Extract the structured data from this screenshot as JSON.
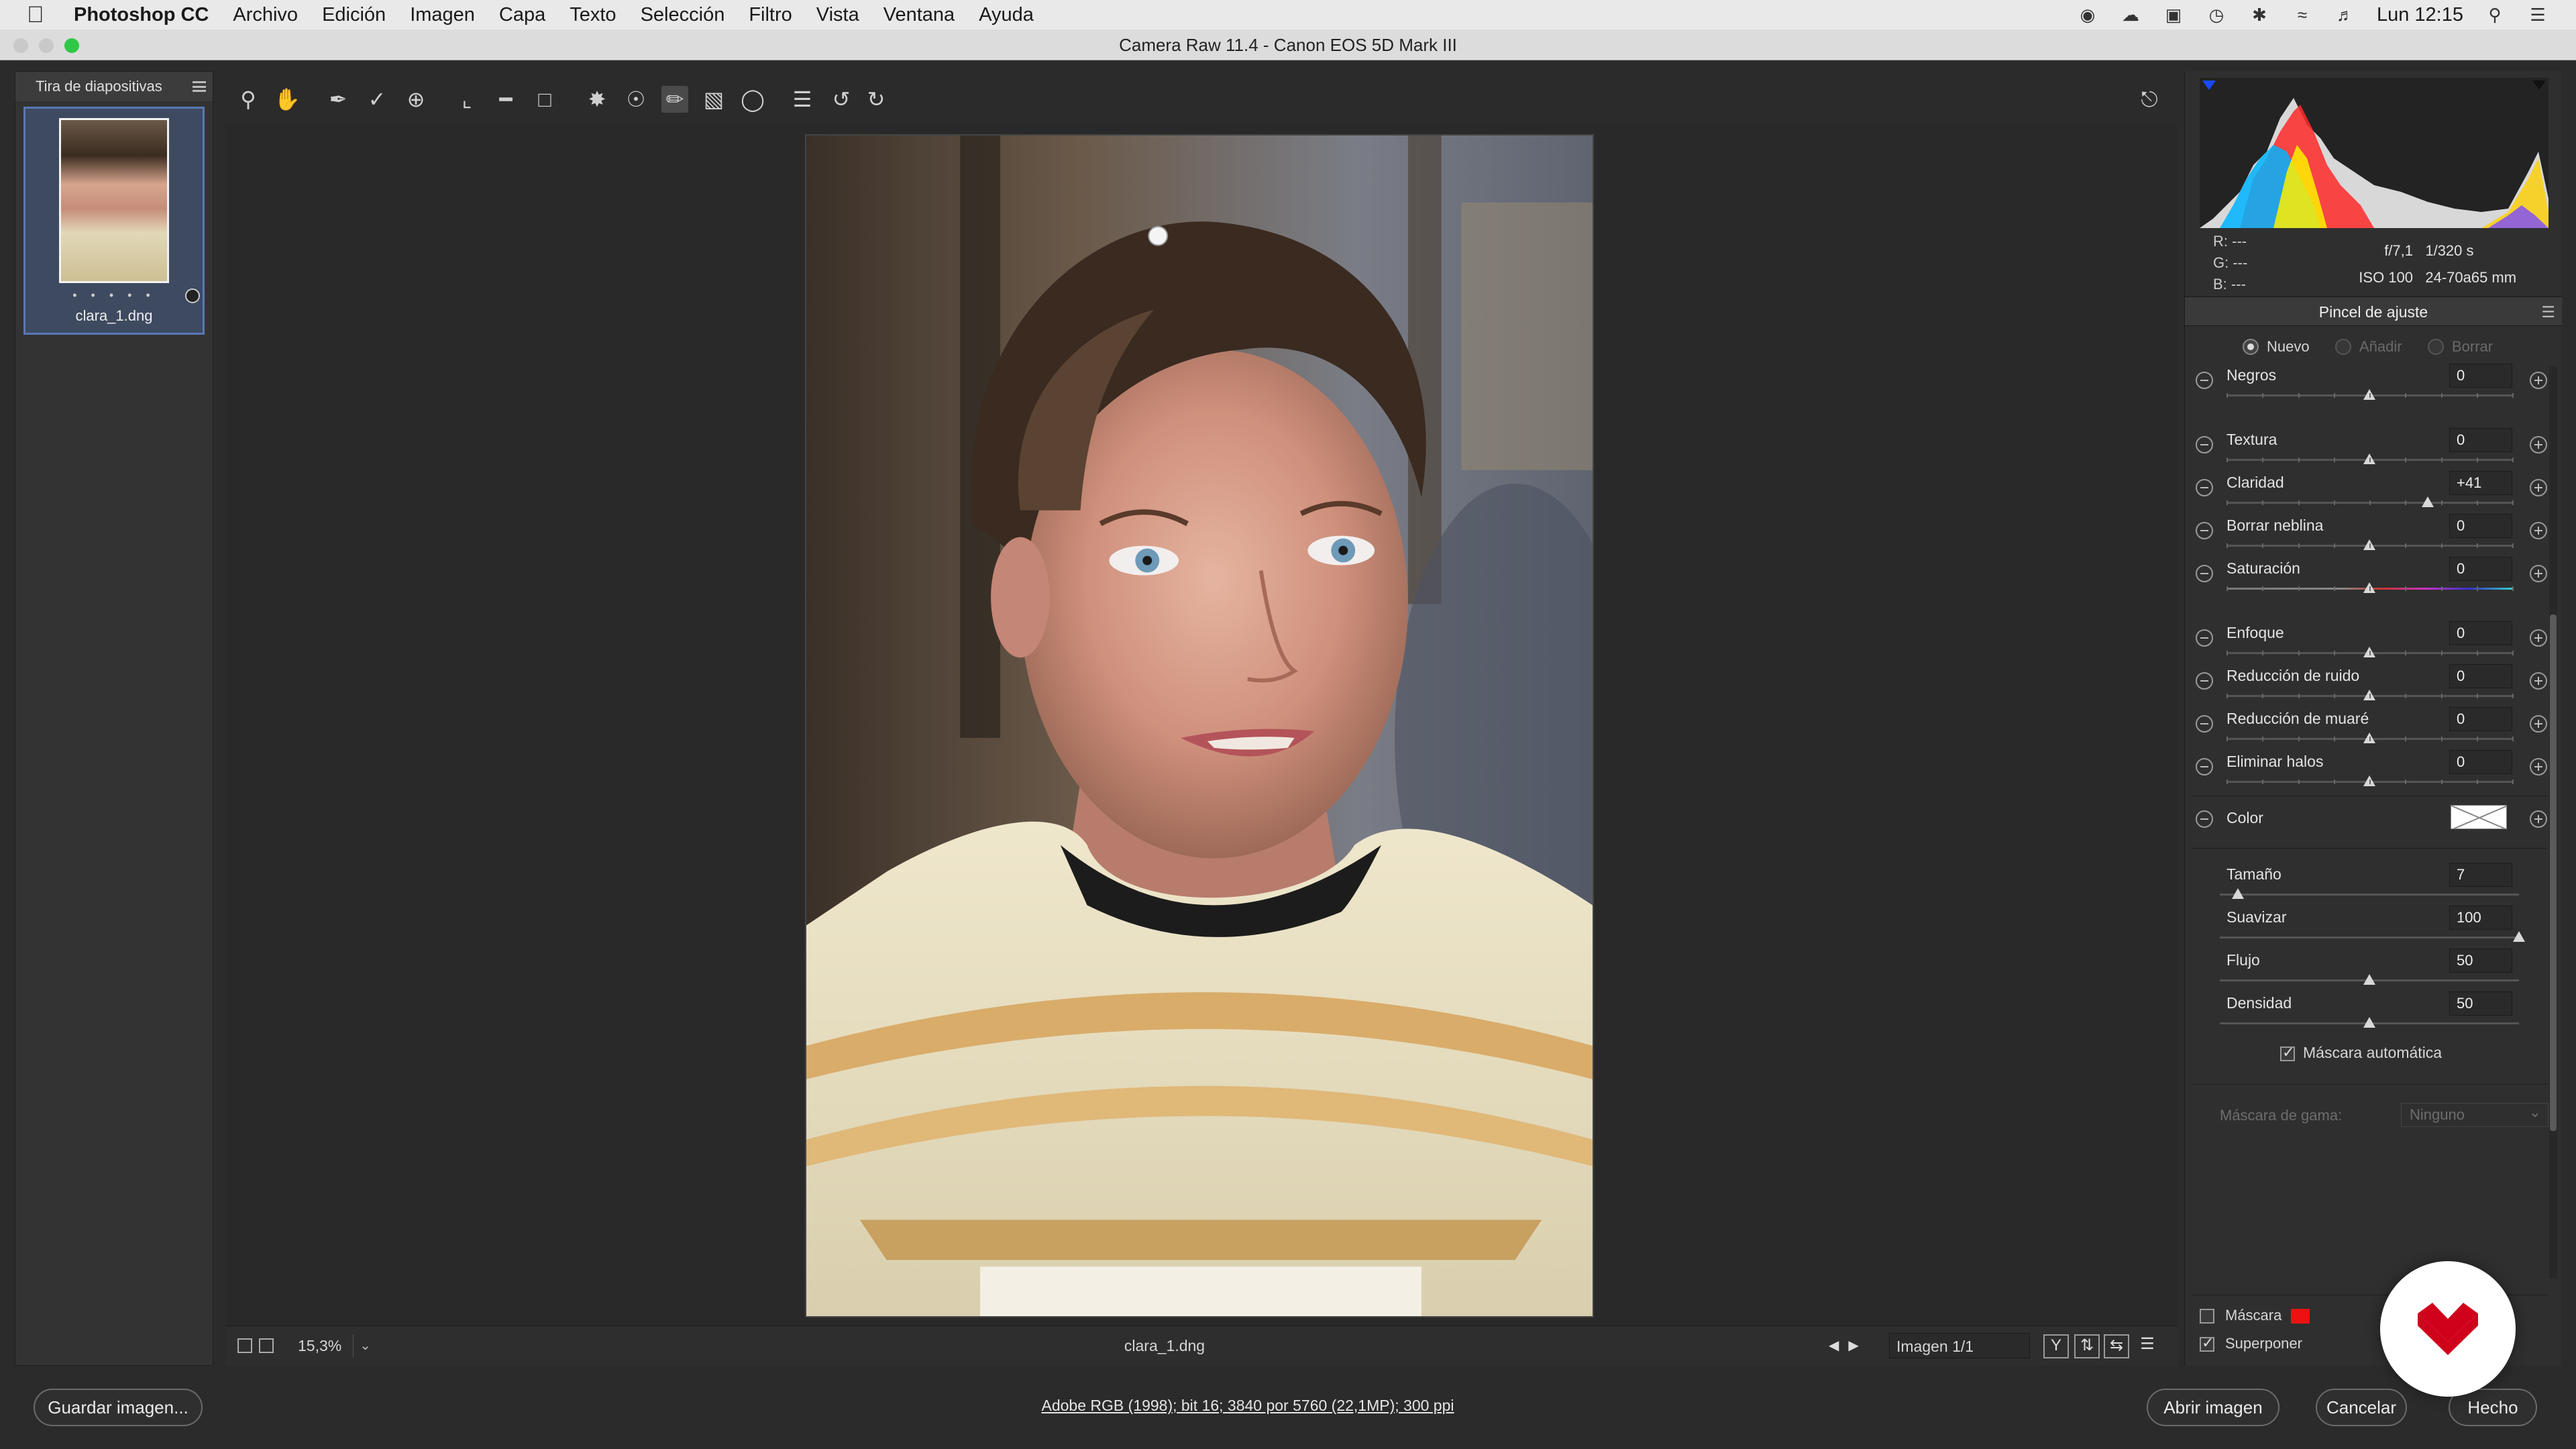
{
  "menubar": {
    "app_name": "Photoshop CC",
    "items": [
      "Archivo",
      "Edición",
      "Imagen",
      "Capa",
      "Texto",
      "Selección",
      "Filtro",
      "Vista",
      "Ventana",
      "Ayuda"
    ],
    "clock": "Lun 12:15"
  },
  "window": {
    "title": "Camera Raw 11.4 -  Canon EOS 5D Mark III"
  },
  "filmstrip": {
    "header": "Tira de diapositivas",
    "rating_dots": "• • • • •",
    "items": [
      {
        "filename": "clara_1.dng"
      }
    ]
  },
  "canvas_bar": {
    "zoom": "15,3%",
    "filename": "clara_1.dng",
    "image_counter": "Imagen 1/1",
    "before_after_label": "Y"
  },
  "histogram": {
    "r_label": "R:",
    "g_label": "G:",
    "b_label": "B:",
    "r_value": "---",
    "g_value": "---",
    "b_value": "---",
    "aperture": "f/7,1",
    "shutter": "1/320 s",
    "iso": "ISO 100",
    "lens": "24-70a65 mm"
  },
  "adjustment_brush": {
    "panel_title": "Pincel de ajuste",
    "modes": [
      {
        "label": "Nuevo",
        "selected": true,
        "enabled": true
      },
      {
        "label": "Añadir",
        "selected": false,
        "enabled": false
      },
      {
        "label": "Borrar",
        "selected": false,
        "enabled": false
      }
    ],
    "sliders": [
      {
        "label": "Negros",
        "value": "0",
        "position": 0.5
      },
      {
        "label": "Textura",
        "value": "0",
        "position": 0.5
      },
      {
        "label": "Claridad",
        "value": "+41",
        "position": 0.705
      },
      {
        "label": "Borrar neblina",
        "value": "0",
        "position": 0.5
      },
      {
        "label": "Saturación",
        "value": "0",
        "position": 0.5
      },
      {
        "label": "Enfoque",
        "value": "0",
        "position": 0.5
      },
      {
        "label": "Reducción de ruido",
        "value": "0",
        "position": 0.5
      },
      {
        "label": "Reducción de muaré",
        "value": "0",
        "position": 0.5
      },
      {
        "label": "Eliminar halos",
        "value": "0",
        "position": 0.5
      }
    ],
    "color_label": "Color",
    "brush_settings": [
      {
        "label": "Tamaño",
        "value": "7",
        "position": 0.06
      },
      {
        "label": "Suavizar",
        "value": "100",
        "position": 1.0
      },
      {
        "label": "Flujo",
        "value": "50",
        "position": 0.5
      },
      {
        "label": "Densidad",
        "value": "50",
        "position": 0.5
      }
    ],
    "auto_mask_label": "Máscara automática",
    "auto_mask_checked": true,
    "range_mask_label": "Máscara de gama:",
    "range_mask_value": "Ninguno",
    "mask_label": "Máscara",
    "mask_checked": false,
    "mask_color": "#ee1111",
    "overlay_label": "Superponer",
    "overlay_checked": true
  },
  "bottom_bar": {
    "save_label": "Guardar imagen...",
    "info_text": "Adobe RGB (1998); bit 16; 3840 por 5760 (22,1MP); 300 ppi",
    "open_label": "Abrir imagen",
    "cancel_label": "Cancelar",
    "done_label": "Hecho"
  },
  "colors": {
    "accent_blue": "#5a78b4",
    "logo_red": "#d0021b"
  }
}
